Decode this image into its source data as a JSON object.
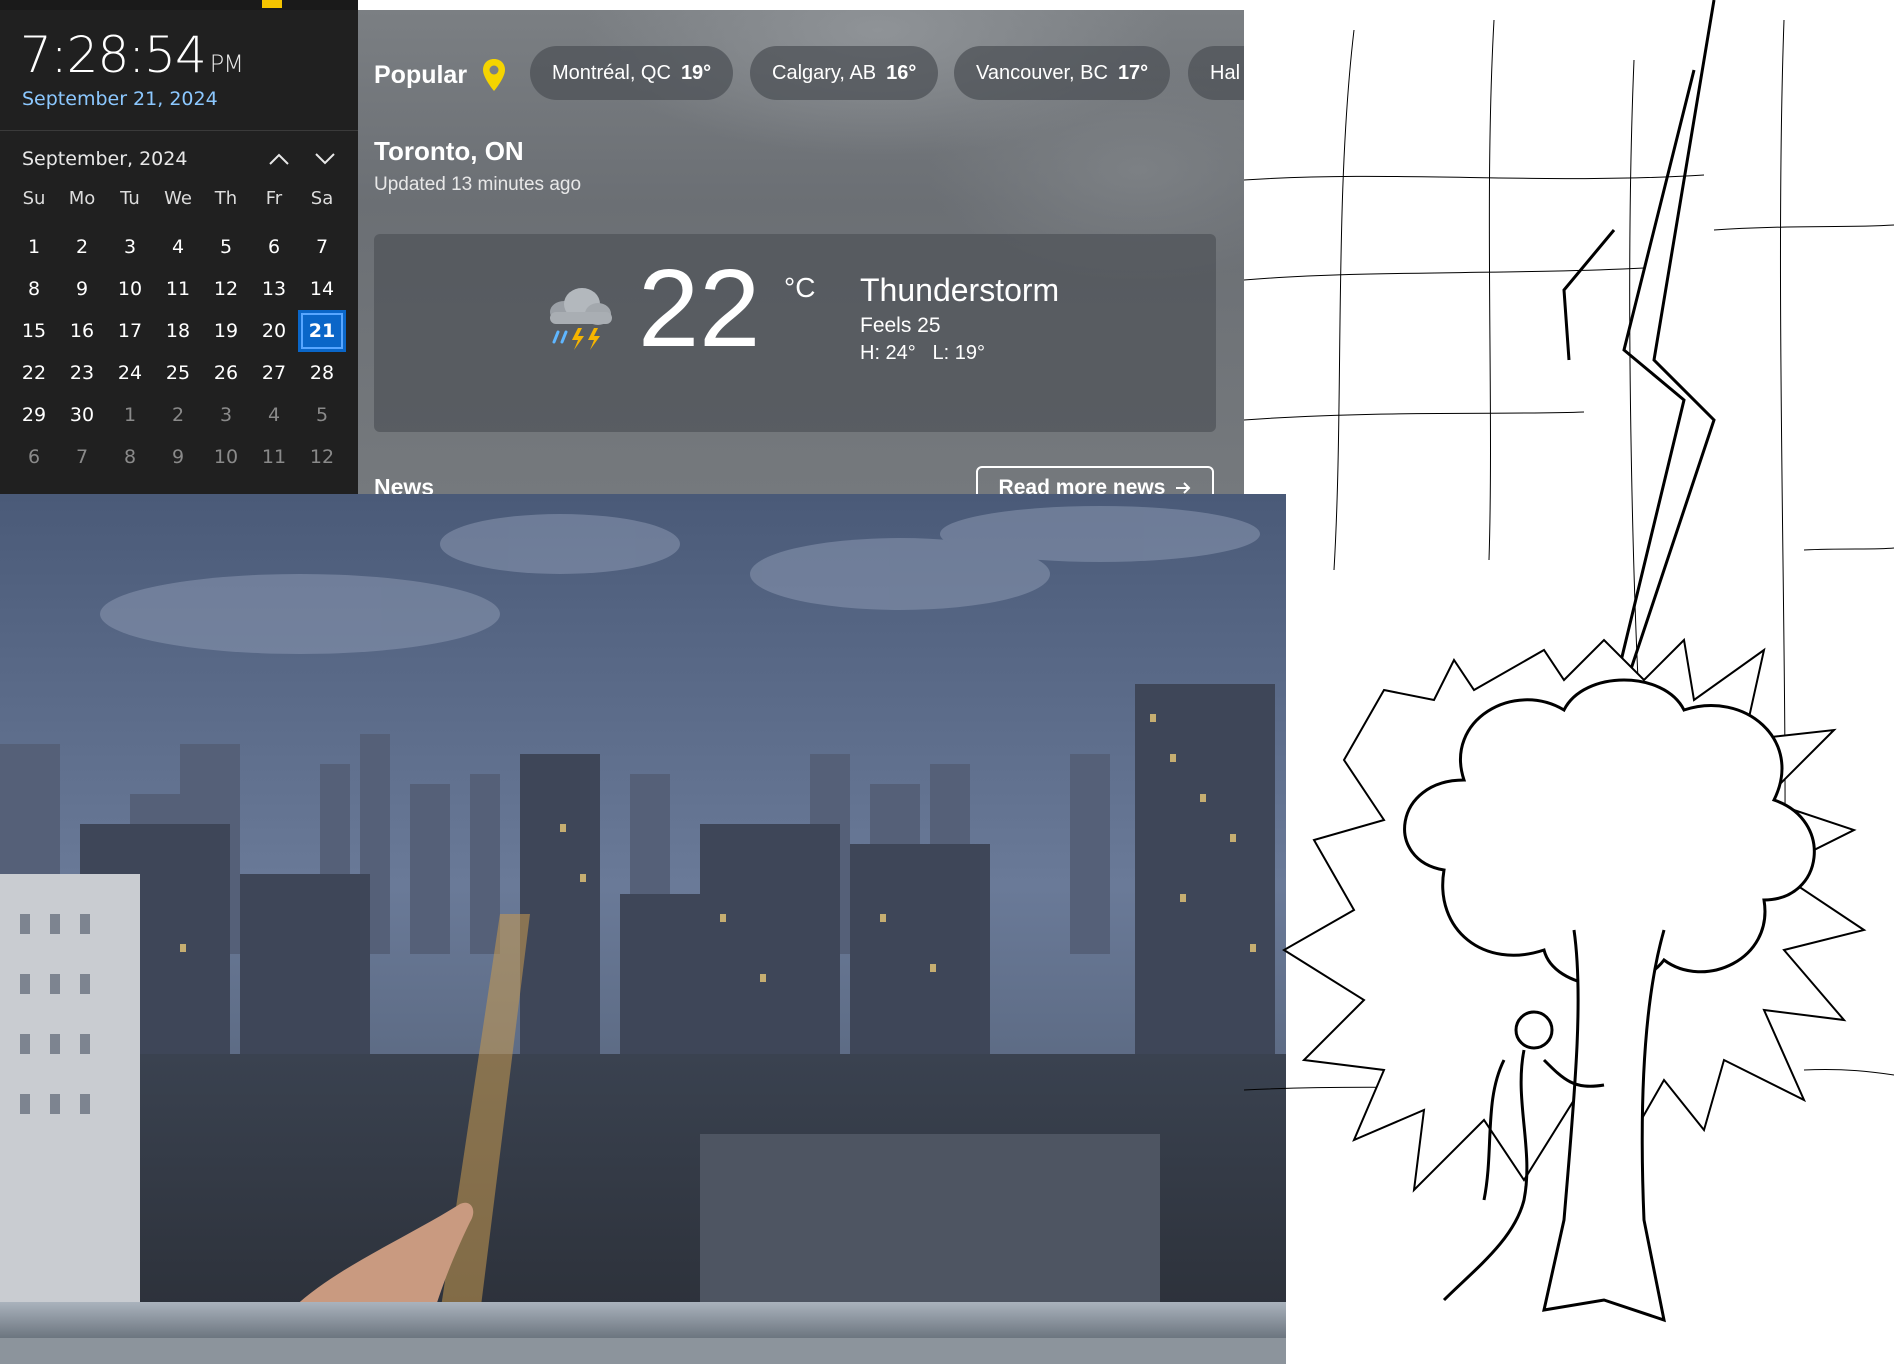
{
  "clock": {
    "time": "7:28:54",
    "ampm": "PM",
    "date": "September 21, 2024"
  },
  "calendar": {
    "month_label": "September, 2024",
    "weekdays": [
      "Su",
      "Mo",
      "Tu",
      "We",
      "Th",
      "Fr",
      "Sa"
    ],
    "weeks": [
      [
        {
          "d": "1"
        },
        {
          "d": "2"
        },
        {
          "d": "3"
        },
        {
          "d": "4"
        },
        {
          "d": "5"
        },
        {
          "d": "6"
        },
        {
          "d": "7"
        }
      ],
      [
        {
          "d": "8"
        },
        {
          "d": "9"
        },
        {
          "d": "10"
        },
        {
          "d": "11"
        },
        {
          "d": "12"
        },
        {
          "d": "13"
        },
        {
          "d": "14"
        }
      ],
      [
        {
          "d": "15"
        },
        {
          "d": "16"
        },
        {
          "d": "17"
        },
        {
          "d": "18"
        },
        {
          "d": "19"
        },
        {
          "d": "20"
        },
        {
          "d": "21",
          "today": true
        }
      ],
      [
        {
          "d": "22"
        },
        {
          "d": "23"
        },
        {
          "d": "24"
        },
        {
          "d": "25"
        },
        {
          "d": "26"
        },
        {
          "d": "27"
        },
        {
          "d": "28"
        }
      ],
      [
        {
          "d": "29"
        },
        {
          "d": "30"
        },
        {
          "d": "1",
          "other": true
        },
        {
          "d": "2",
          "other": true
        },
        {
          "d": "3",
          "other": true
        },
        {
          "d": "4",
          "other": true
        },
        {
          "d": "5",
          "other": true
        }
      ],
      [
        {
          "d": "6",
          "other": true
        },
        {
          "d": "7",
          "other": true
        },
        {
          "d": "8",
          "other": true
        },
        {
          "d": "9",
          "other": true
        },
        {
          "d": "10",
          "other": true
        },
        {
          "d": "11",
          "other": true
        },
        {
          "d": "12",
          "other": true
        }
      ]
    ],
    "icons": {
      "prev": "chevron-up-icon",
      "next": "chevron-down-icon"
    }
  },
  "weather": {
    "popular_label": "Popular",
    "popular_icon": "location-pin-icon",
    "popular_cities": [
      {
        "name": "Montréal, QC",
        "temp": "19°"
      },
      {
        "name": "Calgary, AB",
        "temp": "16°"
      },
      {
        "name": "Vancouver, BC",
        "temp": "17°"
      },
      {
        "name": "Hal",
        "temp": ""
      }
    ],
    "location": "Toronto, ON",
    "updated": "Updated 13 minutes ago",
    "current": {
      "temp": "22",
      "unit": "°C",
      "condition": "Thunderstorm",
      "feels": "Feels 25",
      "high": "H: 24°",
      "low": "L: 19°",
      "icon": "thunderstorm-icon"
    },
    "news_label": "News",
    "read_more": "Read more news",
    "read_more_icon": "arrow-right-icon"
  },
  "colors": {
    "calendar_bg": "#202020",
    "today_accent": "#0a66c8",
    "date_blue": "#8cc8ff",
    "pin_yellow": "#f5d400"
  }
}
